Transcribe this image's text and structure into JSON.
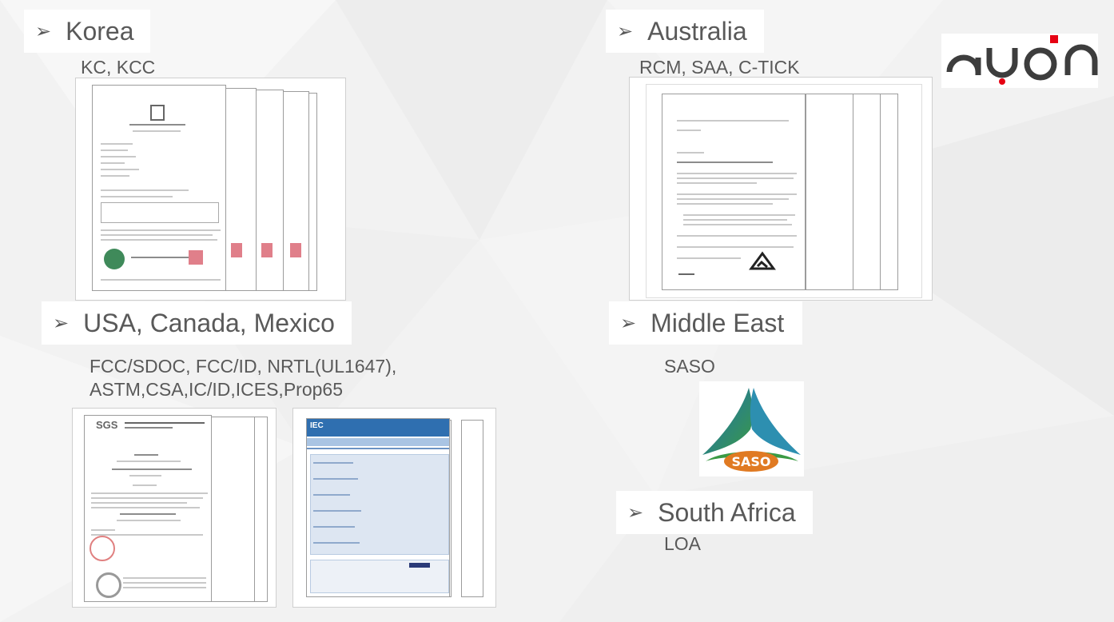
{
  "sections": {
    "korea": {
      "title": "Korea",
      "certs": "KC, KCC"
    },
    "australia": {
      "title": "Australia",
      "certs": "RCM, SAA, C-TICK"
    },
    "usa": {
      "title": "USA, Canada, Mexico",
      "certs_line1": "FCC/SDOC, FCC/ID, NRTL(UL1647),",
      "certs_line2": "ASTM,CSA,IC/ID,ICES,Prop65"
    },
    "middle_east": {
      "title": "Middle East",
      "certs": "SASO"
    },
    "south_africa": {
      "title": "South Africa",
      "certs": "LOA"
    }
  },
  "logos": {
    "saso_text": "SASO",
    "sgs_text": "SGS",
    "iec_text": "IEC"
  },
  "colors": {
    "brand_dark": "#3d3d3d",
    "brand_red": "#e60012",
    "saso_orange": "#e07a22",
    "saso_blue": "#1f6fb5",
    "saso_green": "#3a9a44"
  },
  "icons": {
    "bullet": "arrow-bullet-icon",
    "brand": "brand-logo-icon"
  }
}
